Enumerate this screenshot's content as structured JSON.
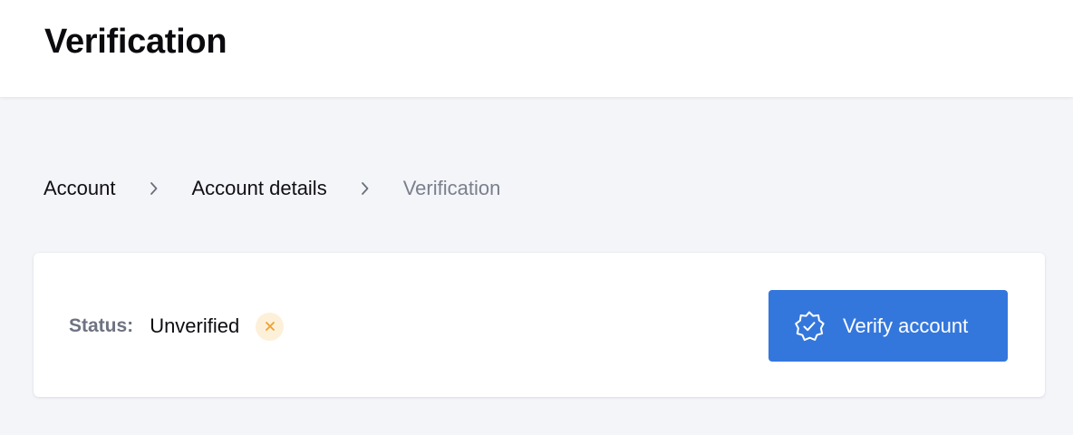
{
  "header": {
    "title": "Verification"
  },
  "breadcrumb": {
    "items": [
      {
        "label": "Account",
        "icon": "chevron-right-icon"
      },
      {
        "label": "Account details",
        "icon": "chevron-right-icon"
      },
      {
        "label": "Verification"
      }
    ]
  },
  "status_card": {
    "label": "Status:",
    "value": "Unverified",
    "badge_icon": "close-icon",
    "badge_color": "#f0a12e",
    "badge_background": "#fdf0d9"
  },
  "verify_button": {
    "label": "Verify account",
    "icon": "verified-badge-icon",
    "background": "#3477dc"
  }
}
